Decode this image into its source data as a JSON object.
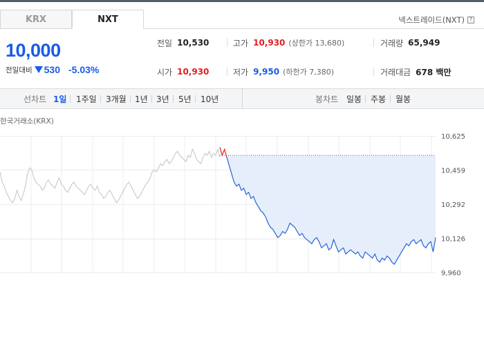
{
  "exchange_tabs": [
    {
      "label": "KRX",
      "active": false
    },
    {
      "label": "NXT",
      "active": true
    }
  ],
  "nxt_link": {
    "label": "넥스트레이드(NXT)",
    "help_icon": "help-icon"
  },
  "price": {
    "current": "10,000",
    "change_label": "전일대비",
    "change_value": "530",
    "change_pct": "-5.03%",
    "direction_icon": "down-triangle-icon"
  },
  "info": {
    "prev_close": {
      "label": "전일",
      "value": "10,530"
    },
    "high": {
      "label": "고가",
      "value": "10,930",
      "sub": "(상한가 13,680)"
    },
    "volume": {
      "label": "거래량",
      "value": "65,949"
    },
    "open": {
      "label": "시가",
      "value": "10,930"
    },
    "low": {
      "label": "저가",
      "value": "9,950",
      "sub": "(하한가 7,380)"
    },
    "amount": {
      "label": "거래대금",
      "value": "678 백만"
    }
  },
  "toolbar": {
    "line_label": "선차트",
    "periods": [
      {
        "label": "1일",
        "active": true
      },
      {
        "label": "1주일",
        "active": false
      },
      {
        "label": "3개월",
        "active": false
      },
      {
        "label": "1년",
        "active": false
      },
      {
        "label": "3년",
        "active": false
      },
      {
        "label": "5년",
        "active": false
      },
      {
        "label": "10년",
        "active": false
      }
    ],
    "candle_label": "봉차트",
    "candles": [
      {
        "label": "일봉"
      },
      {
        "label": "주봉"
      },
      {
        "label": "월봉"
      }
    ]
  },
  "chart_source": "한국거래소(KRX)",
  "chart_data": {
    "type": "line",
    "ylim": [
      9960,
      10625
    ],
    "y_ticks": [
      "10,625",
      "10,459",
      "10,292",
      "10,126",
      "9,960"
    ],
    "reference_price": 10530,
    "colors": {
      "prev": "#c8c8c8",
      "rise": "#e03030",
      "fall": "#2563d6",
      "fill": "#e6eefb"
    },
    "series": [
      {
        "values": [
          10450,
          10400,
          10380,
          10350,
          10330,
          10310,
          10300,
          10320,
          10360,
          10330,
          10310,
          10340,
          10380,
          10440,
          10470,
          10460,
          10420,
          10400,
          10390,
          10380,
          10360,
          10370,
          10400,
          10410,
          10390,
          10380,
          10370,
          10400,
          10420,
          10390,
          10380,
          10360,
          10350,
          10370,
          10390,
          10400,
          10380,
          10370,
          10360,
          10350,
          10340,
          10360,
          10380,
          10390,
          10370,
          10360,
          10380,
          10350,
          10340,
          10320,
          10330,
          10350,
          10360,
          10340,
          10320,
          10300,
          10310,
          10330,
          10350,
          10370,
          10390,
          10400,
          10380,
          10360,
          10340,
          10320,
          10330,
          10350,
          10370,
          10390,
          10400,
          10420,
          10450,
          10460,
          10450,
          10470,
          10490,
          10480,
          10500,
          10510,
          10490,
          10500,
          10520,
          10540,
          10550,
          10530,
          10520,
          10510,
          10500,
          10530,
          10520,
          10560,
          10540,
          10510,
          10500,
          10490,
          10520,
          10540,
          10530,
          10550,
          10520,
          10540,
          10530,
          10560,
          10520
        ]
      },
      {
        "values": [
          10570,
          10530,
          10560,
          10520
        ]
      },
      {
        "values": [
          10520,
          10480,
          10440,
          10400,
          10380,
          10390,
          10360,
          10370,
          10340,
          10350,
          10320,
          10330,
          10300,
          10280,
          10260,
          10250,
          10230,
          10200,
          10180,
          10170,
          10150,
          10130,
          10140,
          10160,
          10150,
          10170,
          10200,
          10190,
          10180,
          10160,
          10140,
          10150,
          10130,
          10120,
          10110,
          10100,
          10120,
          10130,
          10110,
          10080,
          10090,
          10100,
          10070,
          10080,
          10120,
          10090,
          10060,
          10070,
          10080,
          10050,
          10060,
          10070,
          10060,
          10050,
          10060,
          10040,
          10030,
          10060,
          10050,
          10040,
          10030,
          10050,
          10020,
          10010,
          10030,
          10020,
          10040,
          10030,
          10010,
          10000,
          10020,
          10040,
          10060,
          10080,
          10100,
          10090,
          10110,
          10120,
          10100,
          10110,
          10120,
          10090,
          10080,
          10100,
          10110,
          10060,
          10130
        ]
      }
    ]
  }
}
